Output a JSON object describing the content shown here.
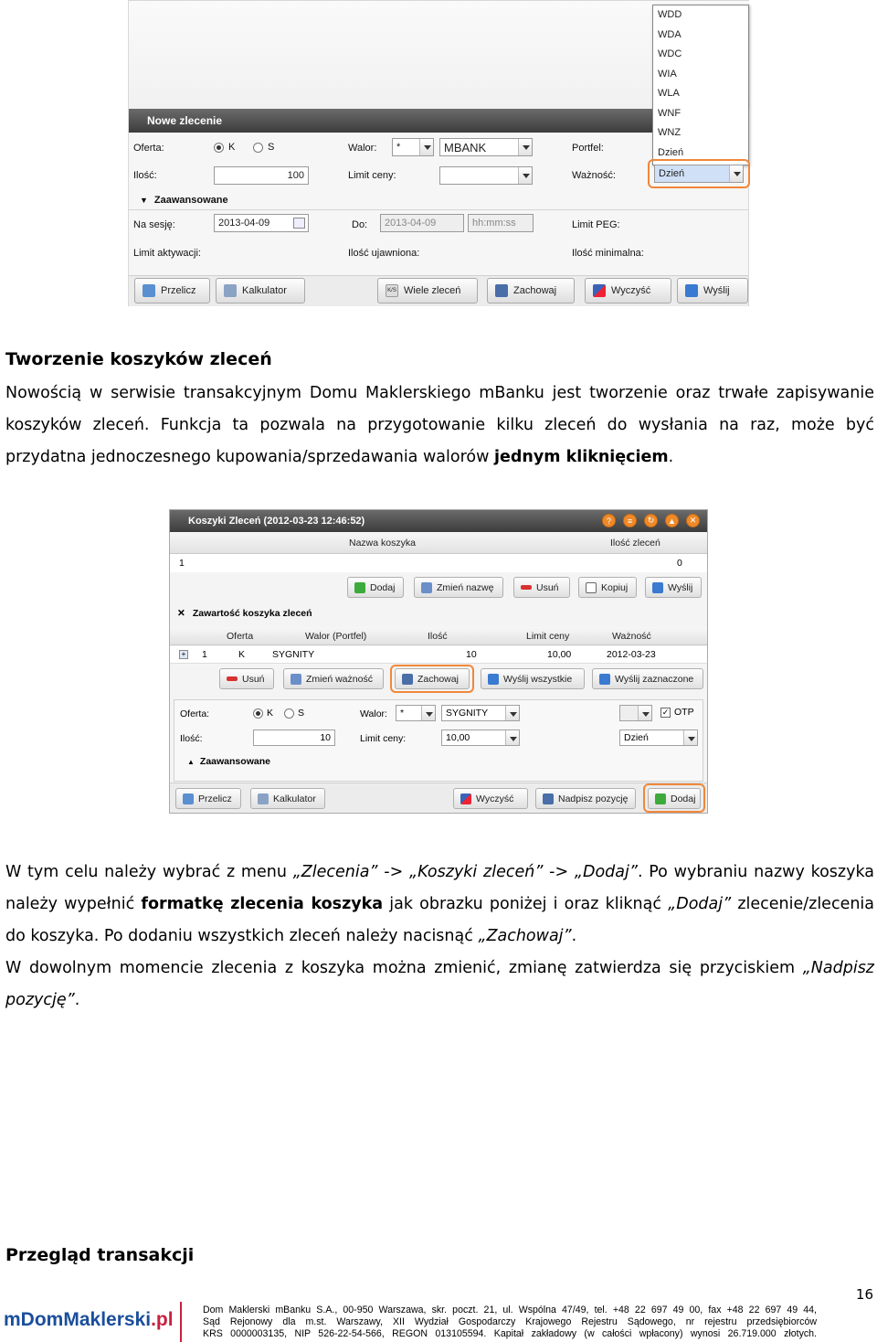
{
  "shot1": {
    "title": "Nowe zlecenie",
    "oferta_label": "Oferta:",
    "radio_k": "K",
    "radio_s": "S",
    "walor_label": "Walor:",
    "walor_filter": "*",
    "walor_value": "MBANK",
    "portfel_label": "Portfel:",
    "ilosc_label": "Ilość:",
    "ilosc_value": "100",
    "limit_ceny_label": "Limit ceny:",
    "waznosc_label": "Ważność:",
    "waznosc_value": "Dzień",
    "advanced_label": "Zaawansowane",
    "na_sesje_label": "Na sesję:",
    "na_sesje_value": "2013-04-09",
    "do_label": "Do:",
    "do_date": "2013-04-09",
    "do_time": "hh:mm:ss",
    "limit_peg_label": "Limit PEG:",
    "limit_aktywacji_label": "Limit aktywacji:",
    "ilosc_ujawniona_label": "Ilość ujawniona:",
    "ilosc_minimalna_label": "Ilość minimalna:",
    "dropdown_options": [
      "WDD",
      "WDA",
      "WDC",
      "WIA",
      "WLA",
      "WNF",
      "WNZ",
      "Dzień"
    ],
    "buttons": {
      "przelicz": "Przelicz",
      "kalkulator": "Kalkulator",
      "ks_badge": "K/S",
      "wiele": "Wiele zleceń",
      "zachowaj": "Zachowaj",
      "wyczysc": "Wyczyść",
      "wyslij": "Wyślij"
    }
  },
  "section1": {
    "heading": "Tworzenie koszyków zleceń",
    "p1": "Nowością w serwisie transakcyjnym Domu Maklerskiego mBanku jest tworzenie oraz trwałe zapisywanie koszyków zleceń. Funkcja ta pozwala na przygotowanie kilku zleceń do wysłania na raz, może być przydatna jednoczesnego kupowania/sprzedawania walorów ",
    "p1_bold": "jednym kliknięciem",
    "p1_end": "."
  },
  "shot2": {
    "title": "Koszyki Zleceń (2012-03-23 12:46:52)",
    "toolbar_icons": [
      "?",
      "≡",
      "↻",
      "▲",
      "✕"
    ],
    "col_name": "Nazwa koszyka",
    "col_count": "Ilość zleceń",
    "row_id": "1",
    "row_count": "0",
    "basket_buttons": {
      "dodaj": "Dodaj",
      "zmien_nazwe": "Zmień nazwę",
      "usun": "Usuń",
      "kopiuj": "Kopiuj",
      "wyslij": "Wyślij"
    },
    "contents_title": "Zawartość koszyka zleceń",
    "contents_cols": [
      "Oferta",
      "Walor (Portfel)",
      "Ilość",
      "Limit ceny",
      "Ważność"
    ],
    "contents_row": {
      "num": "1",
      "oferta": "K",
      "walor": "SYGNITY",
      "ilosc": "10",
      "limit": "10,00",
      "waznosc": "2012-03-23"
    },
    "contents_buttons": {
      "usun": "Usuń",
      "zmien_waznosc": "Zmień ważność",
      "zachowaj": "Zachowaj",
      "wyslij_wszystkie": "Wyślij wszystkie",
      "wyslij_zaznaczone": "Wyślij zaznaczone"
    },
    "form": {
      "oferta_label": "Oferta:",
      "radio_k": "K",
      "radio_s": "S",
      "walor_label": "Walor:",
      "walor_filter": "*",
      "walor_value": "SYGNITY",
      "otp_label": "OTP",
      "ilosc_label": "Ilość:",
      "ilosc_value": "10",
      "limit_label": "Limit ceny:",
      "limit_value": "10,00",
      "waznosc_value": "Dzień",
      "advanced_label": "Zaawansowane"
    },
    "bottom_buttons": {
      "przelicz": "Przelicz",
      "kalkulator": "Kalkulator",
      "wyczysc": "Wyczyść",
      "nadpisz": "Nadpisz pozycję",
      "dodaj": "Dodaj"
    }
  },
  "section2": {
    "t1": "W tym celu należy wybrać z menu ",
    "i1": "„Zlecenia”",
    "t2": " -> ",
    "i2": "„Koszyki zleceń”",
    "t3": " -> ",
    "i3": "„Dodaj”",
    "t4": ". Po wybraniu nazwy koszyka należy wypełnić ",
    "b1": "formatkę zlecenia koszyka",
    "t5": " jak obrazku poniżej i oraz kliknąć ",
    "i4": "„Dodaj”",
    "t6": " zlecenie/zlecenia do koszyka. Po dodaniu wszystkich zleceń należy nacisnąć ",
    "i5": "„Zachowaj”",
    "t7": ".",
    "p2a": "W dowolnym momencie zlecenia z koszyka można zmienić, zmianę zatwierdza się przyciskiem ",
    "p2i": "„Nadpisz pozycję”",
    "p2b": "."
  },
  "section3": {
    "heading": "Przegląd transakcji"
  },
  "footer": {
    "page_number": "16",
    "logo_main": "mDomMaklerski",
    "logo_suffix": ".pl",
    "line1": "Dom Maklerski mBanku S.A., 00-950 Warszawa, skr. poczt. 21, ul. Wspólna 47/49, tel. +48 22 697 49 00, fax +48 22 697 49 44,",
    "line2": "Sąd Rejonowy dla m.st. Warszawy, XII Wydział Gospodarczy Krajowego Rejestru Sądowego, nr rejestru przedsiębiorców",
    "line3": "KRS 0000003135, NIP 526-22-54-566, REGON 013105594. Kapitał zakładowy (w całości wpłacony) wynosi 26.719.000 złotych."
  }
}
